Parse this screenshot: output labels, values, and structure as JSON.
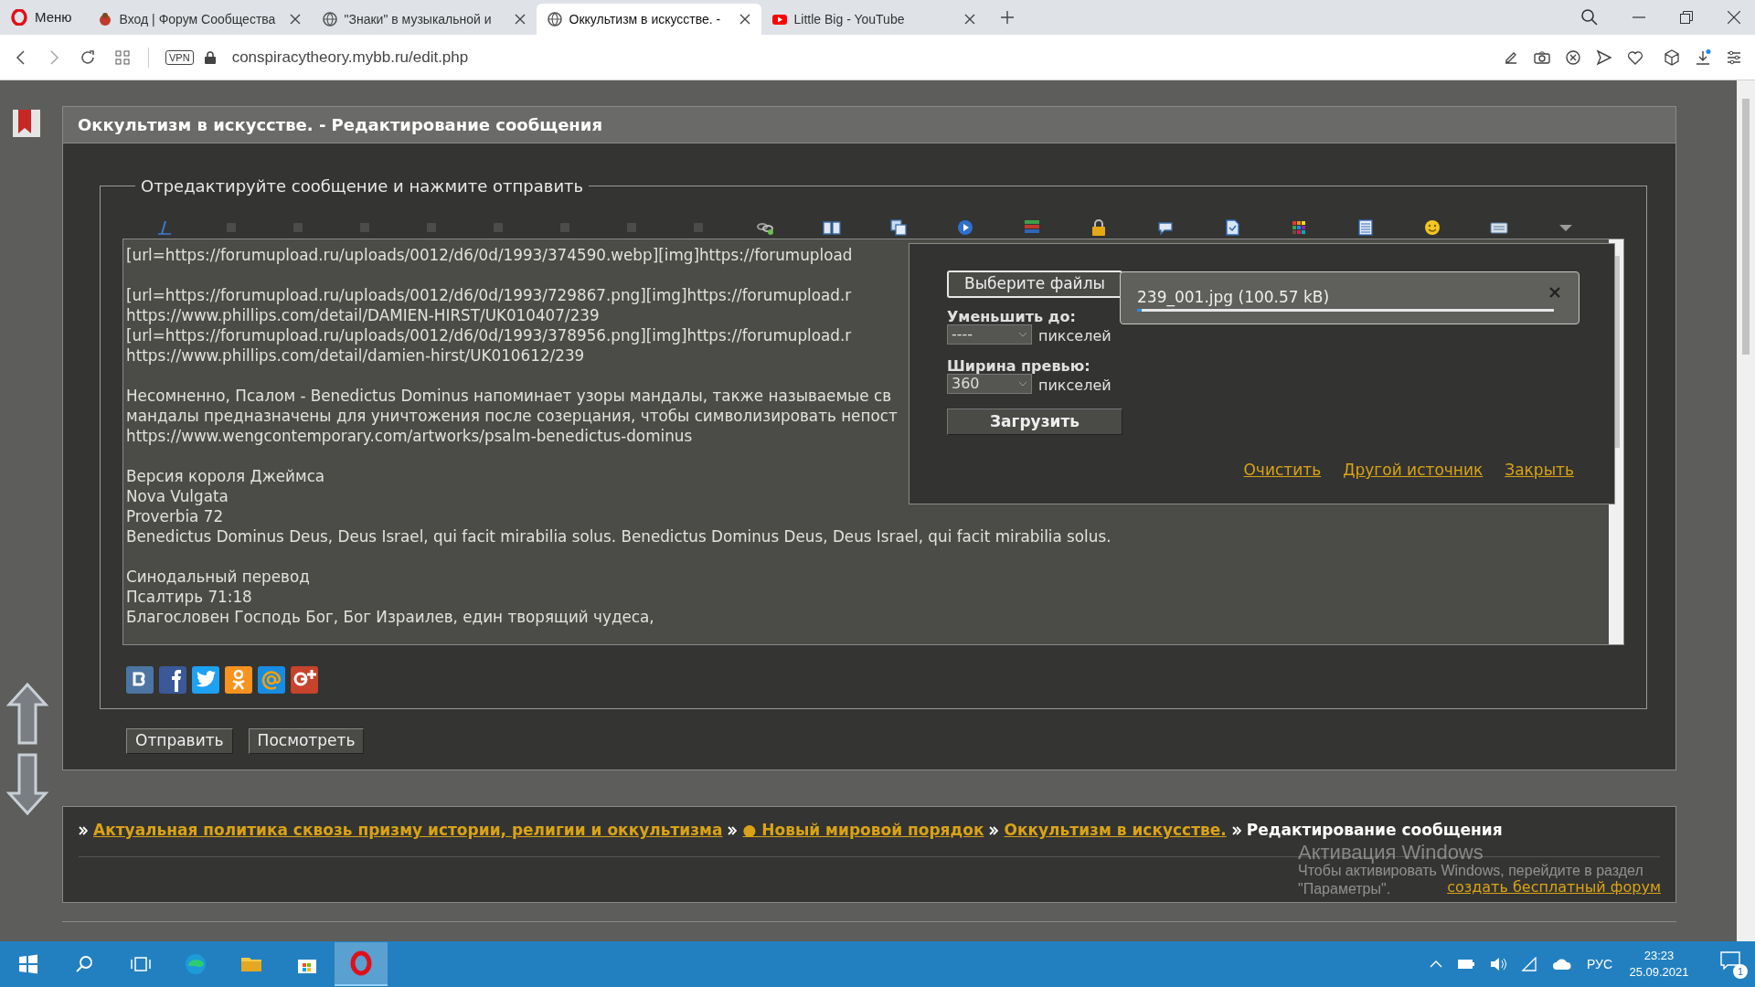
{
  "browser": {
    "menu_label": "Меню",
    "tabs": [
      {
        "title": "Вход | Форум Сообщества",
        "selected": false
      },
      {
        "title": "\"Знаки\" в музыкальной и",
        "selected": false
      },
      {
        "title": "Оккультизм в искусстве. -",
        "selected": true
      },
      {
        "title": "Little Big - YouTube",
        "selected": false
      }
    ],
    "vpn_badge": "VPN",
    "address": "conspiracytheory.mybb.ru/edit.php"
  },
  "page": {
    "title": "Оккультизм в искусстве. - Редактирование сообщения",
    "legend": "Отредактируйте сообщение и нажмите отправить",
    "message_paragraphs": [
      [
        "[url=https://forumupload.ru/uploads/0012/d6/0d/1993/374590.webp][img]https://forumupload"
      ],
      [
        "[url=https://forumupload.ru/uploads/0012/d6/0d/1993/729867.png][img]https://forumupload.r",
        "https://www.phillips.com/detail/DAMIEN-HIRST/UK010407/239",
        "[url=https://forumupload.ru/uploads/0012/d6/0d/1993/378956.png][img]https://forumupload.r",
        "https://www.phillips.com/detail/damien-hirst/UK010612/239"
      ],
      [
        "Несомненно, Псалом - Benedictus Dominus напоминает узоры мандалы, также называемые св",
        "мандалы предназначены для уничтожения после созерцания, чтобы символизировать непост",
        "https://www.wengcontemporary.com/artworks/psalm-benedictus-dominus"
      ],
      [
        "Версия короля Джеймса",
        "Nova Vulgata",
        "Proverbia 72",
        "Benedictus Dominus Deus, Deus Israel, qui facit mirabilia solus. Benedictus Dominus Deus, Deus Israel, qui facit mirabilia solus."
      ],
      [
        "Синодальный перевод",
        "Псалтирь 71:18",
        "Благословен Господь Бог, Бог Израилев, един творящий чудеса,"
      ]
    ],
    "upload_popup": {
      "choose_button": "Выберите файлы",
      "file": {
        "name": "239_001.jpg (100.57 kB)",
        "level": 0.01
      },
      "fields": [
        {
          "label": "Уменьшить до:",
          "value": "----",
          "unit": "пикселей"
        },
        {
          "label": "Ширина превью:",
          "value": "360",
          "unit": "пикселей"
        }
      ],
      "upload_button": "Загрузить",
      "links": [
        "Очистить",
        "Другой источник",
        "Закрыть"
      ]
    },
    "buttons": [
      "Отправить",
      "Посмотреть"
    ],
    "breadcrumb": [
      {
        "kind": "link",
        "text": "Актуальная политика сквозь призму истории, религии и оккультизма"
      },
      {
        "kind": "link",
        "text": "● Новый мировой порядок"
      },
      {
        "kind": "link",
        "text": "Оккультизм в искусстве."
      },
      {
        "kind": "current",
        "text": "Редактирование сообщения"
      }
    ],
    "footer_link": "создать бесплатный форум"
  },
  "os_notice": {
    "title": "Активация Windows",
    "lines": [
      "Чтобы активировать Windows, перейдите в раздел",
      "\"Параметры\"."
    ]
  },
  "taskbar": {
    "language": "РУС",
    "time": "23:23",
    "date": "25.09.2021",
    "notifications": "1"
  }
}
